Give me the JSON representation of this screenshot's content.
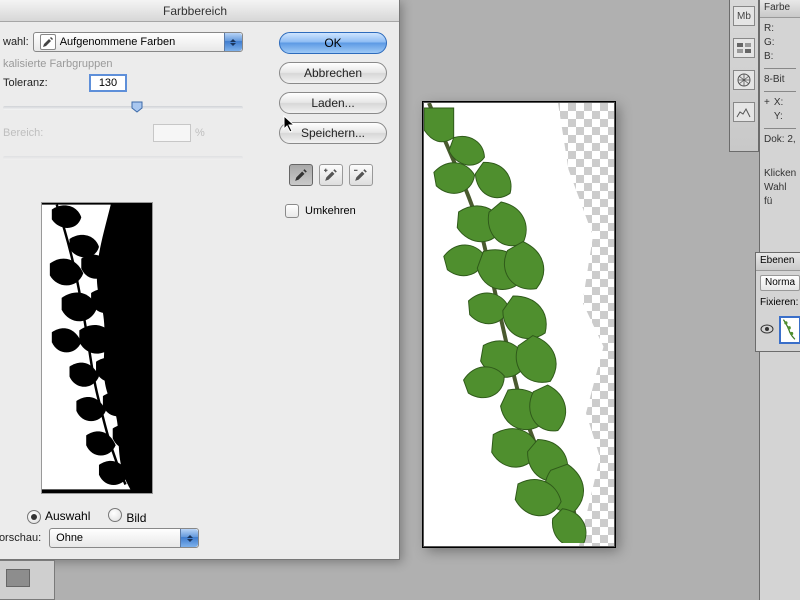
{
  "dialog": {
    "title": "Farbbereich",
    "select_label": "wahl:",
    "select_value": "Aufgenommene Farben",
    "localized_groups_label": "kalisierte Farbgruppen",
    "tolerance_label": "Toleranz:",
    "tolerance_value": "130",
    "range_label": "Bereich:",
    "range_unit": "%",
    "radio_selection": "Auswahl",
    "radio_image": "Bild",
    "preview_label": "lvorschau:",
    "preview_value": "Ohne"
  },
  "buttons": {
    "ok": "OK",
    "cancel": "Abbrechen",
    "load": "Laden...",
    "save": "Speichern..."
  },
  "invert": {
    "label": "Umkehren"
  },
  "right_panel": {
    "color_tab": "Farbe",
    "r": "R:",
    "g": "G:",
    "b": "B:",
    "bit": "8-Bit",
    "x": "X:",
    "y": "Y:",
    "doc": "Dok: 2,",
    "hint1": "Klicken",
    "hint2": "Wahl fü"
  },
  "layers_panel": {
    "tab": "Ebenen",
    "mode": "Norma",
    "lock": "Fixieren:"
  }
}
